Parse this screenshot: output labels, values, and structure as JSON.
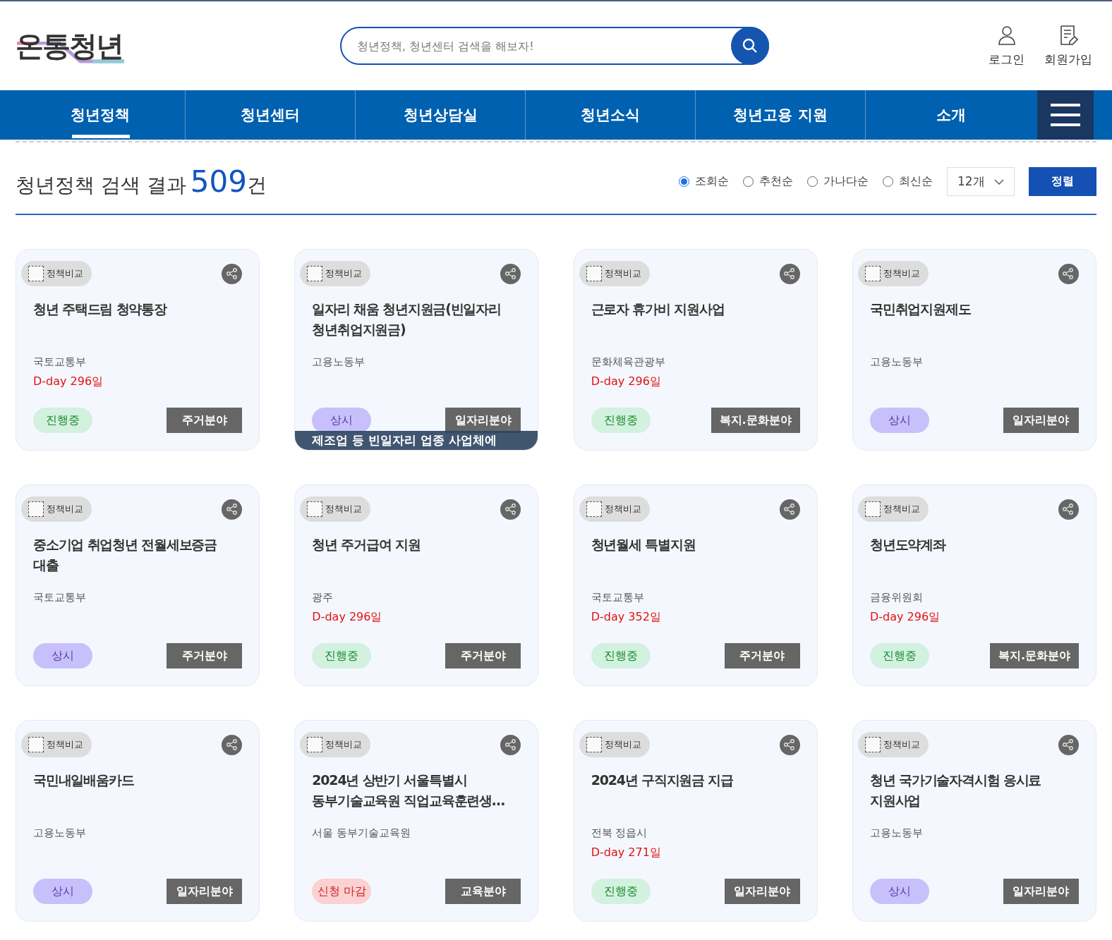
{
  "logo": "온통청년",
  "search": {
    "placeholder": "청년정책, 청년센터 검색을 해보자!"
  },
  "user_links": [
    {
      "kind": "login",
      "label": "로그인"
    },
    {
      "kind": "signup",
      "label": "회원가입"
    }
  ],
  "nav": [
    {
      "label": "청년정책",
      "selected": true
    },
    {
      "label": "청년센터",
      "selected": false
    },
    {
      "label": "청년상담실",
      "selected": false
    },
    {
      "label": "청년소식",
      "selected": false
    },
    {
      "label": "청년고용 지원",
      "selected": false
    },
    {
      "label": "소개",
      "selected": false
    }
  ],
  "result": {
    "prefix": "청년정책 검색 결과",
    "count": "509",
    "suffix": "건"
  },
  "sort_options": [
    {
      "label": "조회순",
      "selected": true
    },
    {
      "label": "추천순",
      "selected": false
    },
    {
      "label": "가나다순",
      "selected": false
    },
    {
      "label": "최신순",
      "selected": false
    }
  ],
  "page_size": "12개",
  "sort_button": "정렬",
  "cards": [
    {
      "compare": "정책비교",
      "compare_checked": false,
      "title": "청년 주택드림 청약통장",
      "agency": "국토교통부",
      "dday": "D-day 296일",
      "status": {
        "kind": "ongoing",
        "label": "진행중"
      },
      "category": "주거분야"
    },
    {
      "compare": "정책비교",
      "compare_checked": false,
      "title": "일자리 채움 청년지원금(빈일자리 청년취업지원금)",
      "agency": "고용노동부",
      "status": {
        "kind": "always",
        "label": "상시"
      },
      "category": "일자리분야",
      "hover_text": "제조업 등 빈일자리 업종 사업체에"
    },
    {
      "compare": "정책비교",
      "compare_checked": false,
      "title": "근로자 휴가비 지원사업",
      "agency": "문화체육관광부",
      "dday": "D-day 296일",
      "status": {
        "kind": "ongoing",
        "label": "진행중"
      },
      "category": "복지.문화분야"
    },
    {
      "compare": "정책비교",
      "compare_checked": false,
      "title": "국민취업지원제도",
      "agency": "고용노동부",
      "status": {
        "kind": "always",
        "label": "상시"
      },
      "category": "일자리분야"
    },
    {
      "compare": "정책비교",
      "compare_checked": false,
      "title": "중소기업 취업청년 전월세보증금 대출",
      "agency": "국토교통부",
      "status": {
        "kind": "always",
        "label": "상시"
      },
      "category": "주거분야"
    },
    {
      "compare": "정책비교",
      "compare_checked": false,
      "title": "청년 주거급여 지원",
      "agency": "광주",
      "dday": "D-day 296일",
      "status": {
        "kind": "ongoing",
        "label": "진행중"
      },
      "category": "주거분야"
    },
    {
      "compare": "정책비교",
      "compare_checked": false,
      "title": "청년월세 특별지원",
      "agency": "국토교통부",
      "dday": "D-day 352일",
      "status": {
        "kind": "ongoing",
        "label": "진행중"
      },
      "category": "주거분야"
    },
    {
      "compare": "정책비교",
      "compare_checked": false,
      "title": "청년도약계좌",
      "agency": "금융위원회",
      "dday": "D-day 296일",
      "status": {
        "kind": "ongoing",
        "label": "진행중"
      },
      "category": "복지.문화분야"
    },
    {
      "compare": "정책비교",
      "compare_checked": false,
      "title": "국민내일배움카드",
      "agency": "고용노동부",
      "status": {
        "kind": "always",
        "label": "상시"
      },
      "category": "일자리분야"
    },
    {
      "compare": "정책비교",
      "compare_checked": false,
      "title": "2024년 상반기 서울특별시 동부기술교육원 직업교육훈련생…",
      "agency": "서울 동부기술교육원",
      "status": {
        "kind": "closed",
        "label": "신청 마감"
      },
      "category": "교육분야"
    },
    {
      "compare": "정책비교",
      "compare_checked": false,
      "title": "2024년 구직지원금 지급",
      "agency": "전북 정읍시",
      "dday": "D-day 271일",
      "status": {
        "kind": "ongoing",
        "label": "진행중"
      },
      "category": "일자리분야"
    },
    {
      "compare": "정책비교",
      "compare_checked": false,
      "title": "청년 국가기술자격시험 응시료 지원사업",
      "agency": "고용노동부",
      "status": {
        "kind": "always",
        "label": "상시"
      },
      "category": "일자리분야"
    }
  ]
}
